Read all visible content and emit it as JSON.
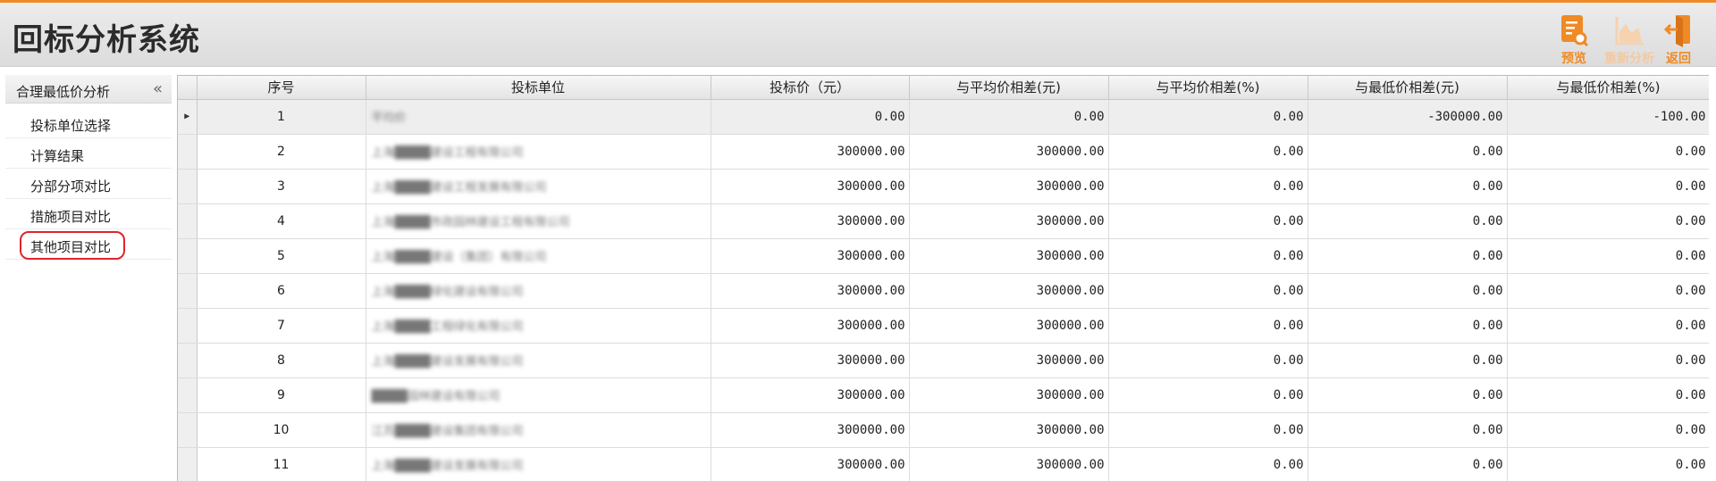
{
  "app": {
    "title": "回标分析系统"
  },
  "toolbar": {
    "preview_label": "预览",
    "reanalyze_label": "重新分析",
    "back_label": "返回"
  },
  "sidebar": {
    "header": "合理最低价分析",
    "collapse_glyph": "«",
    "items": [
      {
        "label": "投标单位选择"
      },
      {
        "label": "计算结果"
      },
      {
        "label": "分部分项对比"
      },
      {
        "label": "措施项目对比"
      },
      {
        "label": "其他项目对比"
      }
    ]
  },
  "table": {
    "columns": [
      "序号",
      "投标单位",
      "投标价（元）",
      "与平均价相差(元)",
      "与平均价相差(%)",
      "与最低价相差(元)",
      "与最低价相差(%)"
    ],
    "rows": [
      {
        "seq": "1",
        "unit": "平均价",
        "price": "0.00",
        "diff_avg": "0.00",
        "diff_avg_pct": "0.00",
        "diff_min": "-300000.00",
        "diff_min_pct": "-100.00"
      },
      {
        "seq": "2",
        "unit": "上海████建设工程有限公司",
        "price": "300000.00",
        "diff_avg": "300000.00",
        "diff_avg_pct": "0.00",
        "diff_min": "0.00",
        "diff_min_pct": "0.00"
      },
      {
        "seq": "3",
        "unit": "上海████建设工程发展有限公司",
        "price": "300000.00",
        "diff_avg": "300000.00",
        "diff_avg_pct": "0.00",
        "diff_min": "0.00",
        "diff_min_pct": "0.00"
      },
      {
        "seq": "4",
        "unit": "上海████市政园林建设工程有限公司",
        "price": "300000.00",
        "diff_avg": "300000.00",
        "diff_avg_pct": "0.00",
        "diff_min": "0.00",
        "diff_min_pct": "0.00"
      },
      {
        "seq": "5",
        "unit": "上海████建设（集团）有限公司",
        "price": "300000.00",
        "diff_avg": "300000.00",
        "diff_avg_pct": "0.00",
        "diff_min": "0.00",
        "diff_min_pct": "0.00"
      },
      {
        "seq": "6",
        "unit": "上海████绿化建设有限公司",
        "price": "300000.00",
        "diff_avg": "300000.00",
        "diff_avg_pct": "0.00",
        "diff_min": "0.00",
        "diff_min_pct": "0.00"
      },
      {
        "seq": "7",
        "unit": "上海████工程绿化有限公司",
        "price": "300000.00",
        "diff_avg": "300000.00",
        "diff_avg_pct": "0.00",
        "diff_min": "0.00",
        "diff_min_pct": "0.00"
      },
      {
        "seq": "8",
        "unit": "上海████建设发展有限公司",
        "price": "300000.00",
        "diff_avg": "300000.00",
        "diff_avg_pct": "0.00",
        "diff_min": "0.00",
        "diff_min_pct": "0.00"
      },
      {
        "seq": "9",
        "unit": "████园林建设有限公司",
        "price": "300000.00",
        "diff_avg": "300000.00",
        "diff_avg_pct": "0.00",
        "diff_min": "0.00",
        "diff_min_pct": "0.00"
      },
      {
        "seq": "10",
        "unit": "江苏████建设集团有限公司",
        "price": "300000.00",
        "diff_avg": "300000.00",
        "diff_avg_pct": "0.00",
        "diff_min": "0.00",
        "diff_min_pct": "0.00"
      },
      {
        "seq": "11",
        "unit": "上海████建设发展有限公司",
        "price": "300000.00",
        "diff_avg": "300000.00",
        "diff_avg_pct": "0.00",
        "diff_min": "0.00",
        "diff_min_pct": "0.00"
      }
    ]
  },
  "colors": {
    "accent": "#f08a24",
    "active_ring": "#e0242c"
  }
}
